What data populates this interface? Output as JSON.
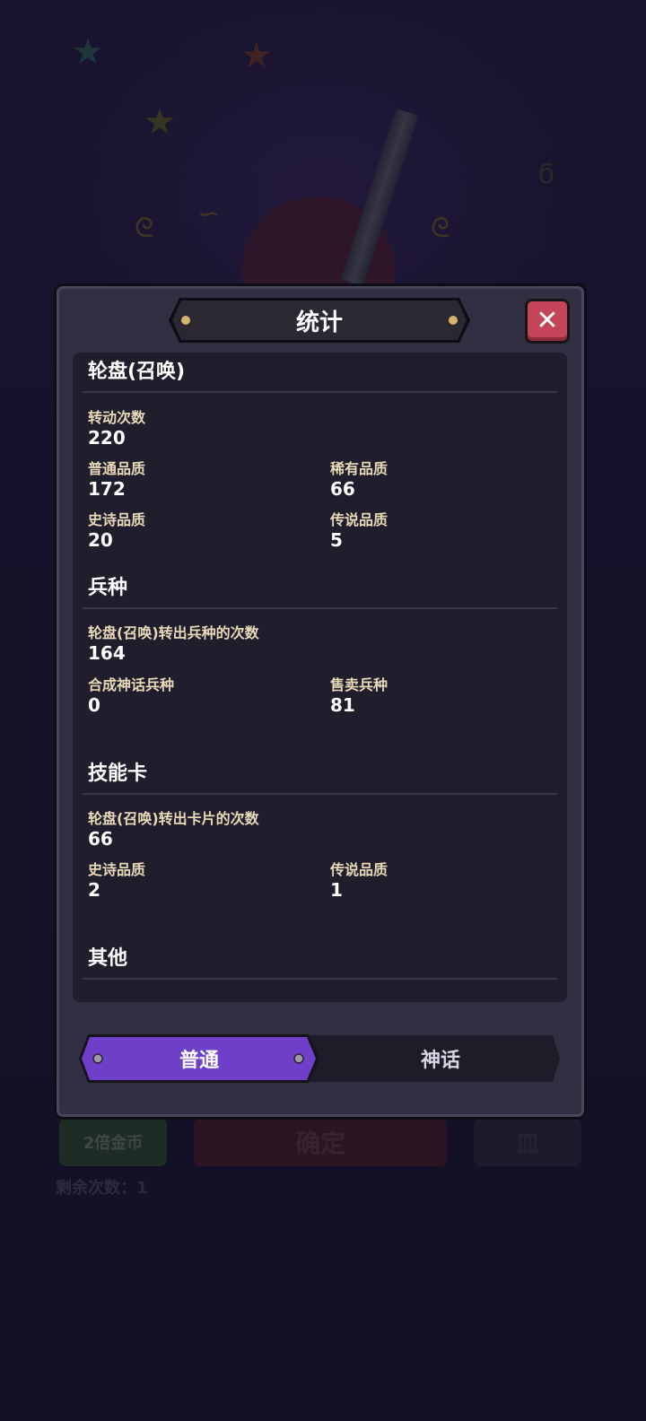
{
  "background": {
    "buttons": {
      "double_gold": "2倍金币",
      "confirm": "确定",
      "third": "皿"
    },
    "remaining": "剩余次数：1"
  },
  "modal": {
    "title": "统计",
    "close_label": "✕"
  },
  "sections": {
    "wheel": {
      "title": "轮盘(召唤)",
      "spins_label": "转动次数",
      "spins_value": "220",
      "normal_label": "普通品质",
      "normal_value": "172",
      "rare_label": "稀有品质",
      "rare_value": "66",
      "epic_label": "史诗品质",
      "epic_value": "20",
      "legend_label": "传说品质",
      "legend_value": "5"
    },
    "units": {
      "title": "兵种",
      "rolled_label": "轮盘(召唤)转出兵种的次数",
      "rolled_value": "164",
      "myth_label": "合成神话兵种",
      "myth_value": "0",
      "sold_label": "售卖兵种",
      "sold_value": "81"
    },
    "skills": {
      "title": "技能卡",
      "rolled_label": "轮盘(召唤)转出卡片的次数",
      "rolled_value": "66",
      "epic_label": "史诗品质",
      "epic_value": "2",
      "legend_label": "传说品质",
      "legend_value": "1"
    },
    "other": {
      "title": "其他"
    }
  },
  "tabs": [
    {
      "label": "普通",
      "active": true
    },
    {
      "label": "神话",
      "active": false
    }
  ],
  "colors": {
    "panel": "#201d2c",
    "modal": "#332f42",
    "tab_active": "#6e3fc8",
    "close": "#c4455a",
    "label": "#e8d9b8"
  }
}
